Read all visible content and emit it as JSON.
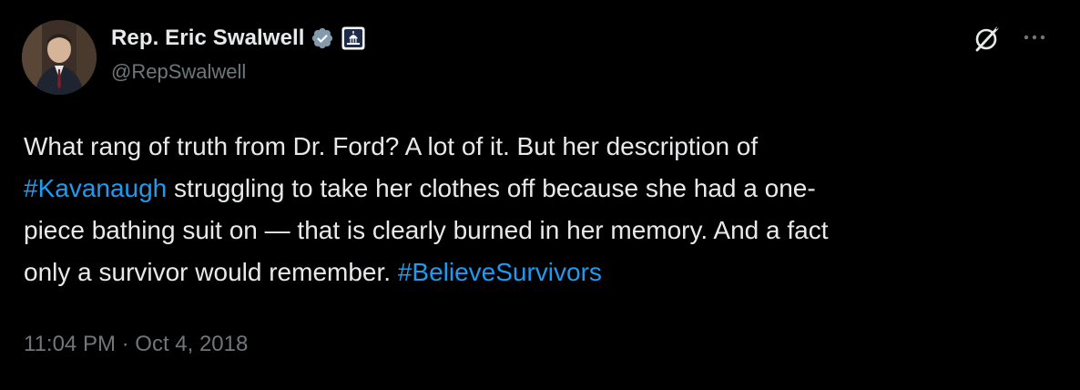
{
  "author": {
    "display_name": "Rep. Eric Swalwell",
    "handle": "@RepSwalwell",
    "verified_icon": "verified-badge-icon",
    "affiliation_icon": "us-capitol-government-icon"
  },
  "actions": {
    "grok_icon": "grok-icon",
    "more_icon": "more-options-icon"
  },
  "tweet": {
    "line1": "What rang of truth from Dr. Ford? A lot of it. But her description of",
    "line2_hashtag": "#Kavanaugh",
    "line2_rest": " struggling to take her clothes off because she had a one-",
    "line3": "piece bathing suit on — that is clearly burned in her memory. And a fact",
    "line4_text": "only a survivor would remember. ",
    "line4_hashtag": "#BelieveSurvivors"
  },
  "meta": {
    "timestamp": "11:04 PM · Oct 4, 2018"
  },
  "colors": {
    "background": "#000000",
    "text": "#e7e9ea",
    "secondary": "#71767b",
    "link": "#1d9bf0"
  }
}
